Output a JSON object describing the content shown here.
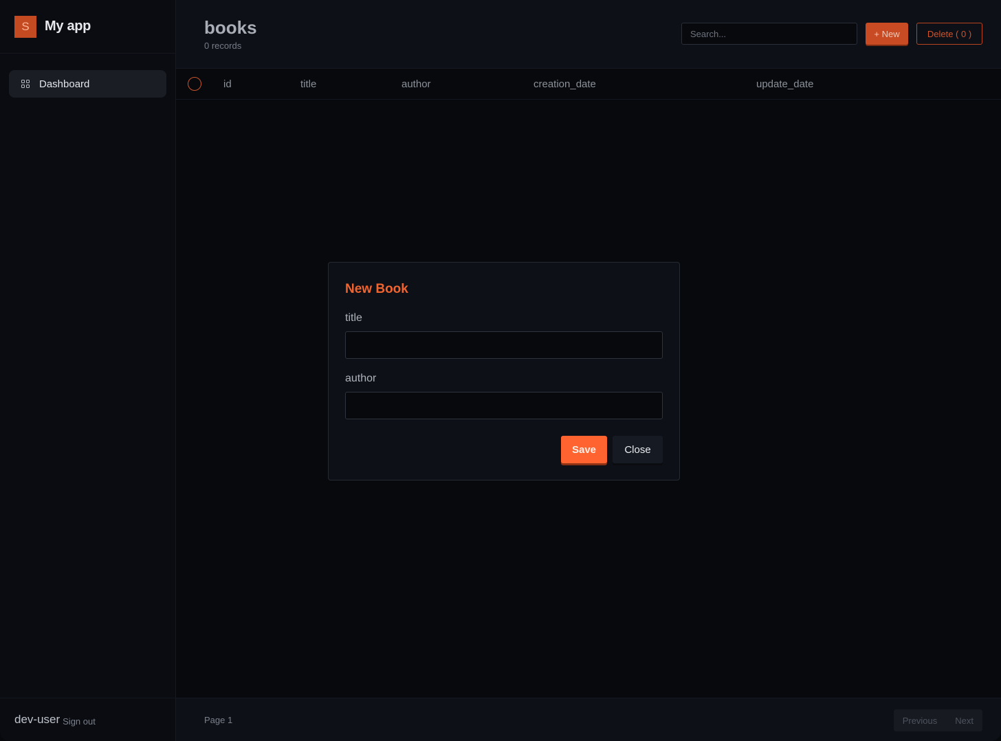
{
  "brand": {
    "logo_letter": "S",
    "name": "My app"
  },
  "nav": {
    "items": [
      {
        "label": "Dashboard",
        "icon": "grid-icon"
      }
    ]
  },
  "user": {
    "name": "dev-user",
    "signout": "Sign out"
  },
  "header": {
    "title": "books",
    "subtitle": "0 records",
    "search_placeholder": "Search...",
    "new_label": "+ New",
    "delete_label": "Delete ( 0 )"
  },
  "table": {
    "columns": [
      "id",
      "title",
      "author",
      "creation_date",
      "update_date"
    ],
    "rows": []
  },
  "footer": {
    "page_label": "Page 1",
    "prev_label": "Previous",
    "next_label": "Next"
  },
  "modal": {
    "title": "New Book",
    "fields": [
      {
        "label": "title",
        "value": ""
      },
      {
        "label": "author",
        "value": ""
      }
    ],
    "save_label": "Save",
    "close_label": "Close"
  },
  "colors": {
    "accent": "#ff6430",
    "accent_dark": "#c94b23",
    "background": "#07090d"
  }
}
